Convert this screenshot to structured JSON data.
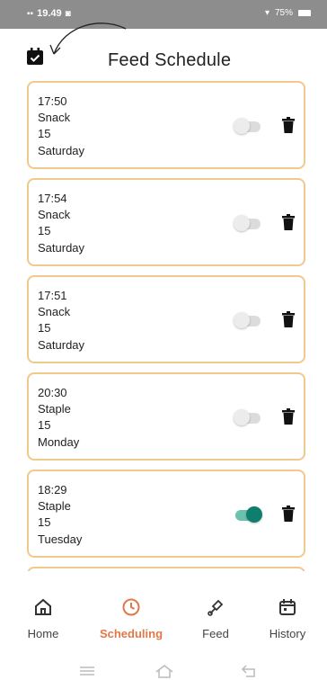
{
  "status_bar": {
    "time": "19.49",
    "battery": "75%"
  },
  "header": {
    "title": "Feed Schedule"
  },
  "schedules": [
    {
      "time": "17:50",
      "type": "Snack",
      "amount": "15",
      "day": "Saturday",
      "enabled": false
    },
    {
      "time": "17:54",
      "type": "Snack",
      "amount": "15",
      "day": "Saturday",
      "enabled": false
    },
    {
      "time": "17:51",
      "type": "Snack",
      "amount": "15",
      "day": "Saturday",
      "enabled": false
    },
    {
      "time": "20:30",
      "type": "Staple",
      "amount": "15",
      "day": "Monday",
      "enabled": false
    },
    {
      "time": "18:29",
      "type": "Staple",
      "amount": "15",
      "day": "Tuesday",
      "enabled": true
    }
  ],
  "nav": {
    "items": [
      {
        "label": "Home",
        "icon": "home-icon",
        "active": false
      },
      {
        "label": "Scheduling",
        "icon": "clock-icon",
        "active": true
      },
      {
        "label": "Feed",
        "icon": "feed-icon",
        "active": false
      },
      {
        "label": "History",
        "icon": "calendar-icon",
        "active": false
      }
    ]
  },
  "colors": {
    "accent": "#e0784a",
    "card_border": "#f0c98c",
    "toggle_on": "#0e7f6e"
  }
}
